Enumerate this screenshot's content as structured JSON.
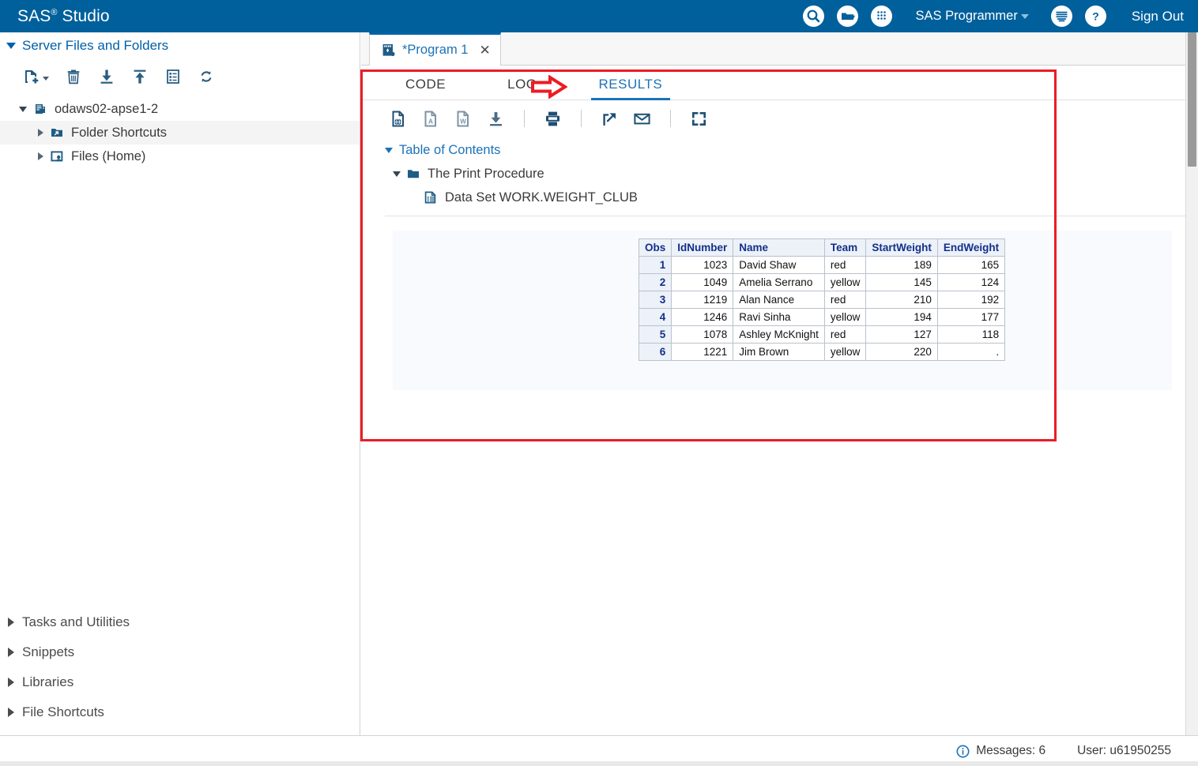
{
  "appbar": {
    "title_main": "SAS",
    "title_sup": "®",
    "title_rest": "Studio",
    "search_icon": "search-icon",
    "open_icon": "open-folder-icon",
    "apps_icon": "apps-grid-icon",
    "role": "SAS Programmer",
    "options_icon": "options-menu-icon",
    "help_icon": "help-icon",
    "signout": "Sign Out",
    "bg_color": "#00609c"
  },
  "sidebar": {
    "header": "Server Files and Folders",
    "toolbar": [
      {
        "name": "new-icon",
        "label": "New"
      },
      {
        "name": "delete-icon",
        "label": "Delete"
      },
      {
        "name": "download-icon",
        "label": "Download"
      },
      {
        "name": "upload-icon",
        "label": "Upload"
      },
      {
        "name": "properties-icon",
        "label": "Properties"
      },
      {
        "name": "refresh-icon",
        "label": "Refresh"
      }
    ],
    "tree": [
      {
        "label": "odaws02-apse1-2",
        "icon": "server-icon",
        "state": "expanded",
        "level": 0
      },
      {
        "label": "Folder Shortcuts",
        "icon": "folder-shortcut-icon",
        "state": "collapsed",
        "level": 1
      },
      {
        "label": "Files (Home)",
        "icon": "home-files-icon",
        "state": "collapsed",
        "level": 1
      }
    ],
    "sections": [
      {
        "label": "Tasks and Utilities"
      },
      {
        "label": "Snippets"
      },
      {
        "label": "Libraries"
      },
      {
        "label": "File Shortcuts"
      }
    ]
  },
  "editor": {
    "doc_tab": {
      "label": "*Program 1",
      "icon": "program-icon",
      "close": "✕"
    },
    "subtabs": [
      {
        "label": "CODE",
        "active": false
      },
      {
        "label": "LOG",
        "active": false
      },
      {
        "label": "RESULTS",
        "active": true
      }
    ],
    "results_toolbar": [
      {
        "name": "html-output-icon",
        "label": "HTML"
      },
      {
        "name": "pdf-output-icon",
        "label": "PDF"
      },
      {
        "name": "word-output-icon",
        "label": "Word"
      },
      {
        "name": "download-results-icon",
        "label": "Download"
      },
      {
        "name": "print-icon",
        "label": "Print"
      },
      {
        "name": "open-in-new-window-icon",
        "label": "Open in new window"
      },
      {
        "name": "email-icon",
        "label": "Email"
      },
      {
        "name": "maximize-icon",
        "label": "Maximize"
      }
    ],
    "toc": {
      "root": "Table of Contents",
      "level1": "The Print Procedure",
      "level2": "Data Set WORK.WEIGHT_CLUB"
    }
  },
  "results_table": {
    "columns": [
      "Obs",
      "IdNumber",
      "Name",
      "Team",
      "StartWeight",
      "EndWeight"
    ],
    "rows": [
      {
        "obs": "1",
        "id": "1023",
        "name": "David Shaw",
        "team": "red",
        "start": "189",
        "end": "165"
      },
      {
        "obs": "2",
        "id": "1049",
        "name": "Amelia Serrano",
        "team": "yellow",
        "start": "145",
        "end": "124"
      },
      {
        "obs": "3",
        "id": "1219",
        "name": "Alan Nance",
        "team": "red",
        "start": "210",
        "end": "192"
      },
      {
        "obs": "4",
        "id": "1246",
        "name": "Ravi Sinha",
        "team": "yellow",
        "start": "194",
        "end": "177"
      },
      {
        "obs": "5",
        "id": "1078",
        "name": "Ashley McKnight",
        "team": "red",
        "start": "127",
        "end": "118"
      },
      {
        "obs": "6",
        "id": "1221",
        "name": "Jim Brown",
        "team": "yellow",
        "start": "220",
        "end": "."
      }
    ]
  },
  "annotation": {
    "highlight_color": "#ec1c24",
    "arrow_icon": "red-arrow-right-icon",
    "arrow_target": "RESULTS"
  },
  "statusbar": {
    "info_icon": "info-icon",
    "messages": "Messages: 6",
    "user": "User: u61950255"
  }
}
